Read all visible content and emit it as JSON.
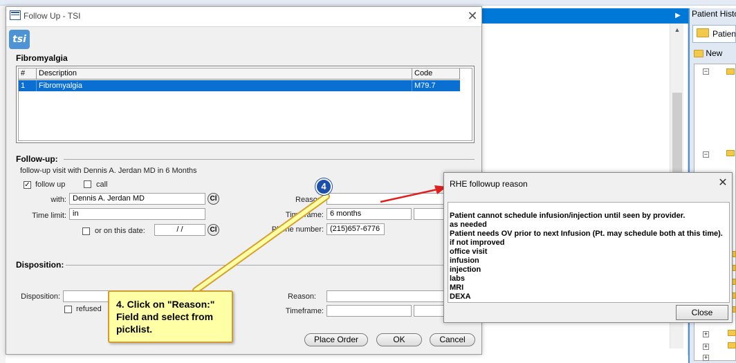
{
  "background_app": {
    "right_panel_title": "Patient Histo",
    "right_panel_tab": "Patien",
    "right_panel_new": "New"
  },
  "dialog": {
    "title": "Follow Up - TSI",
    "logo_text": "tsi",
    "diagnosis": {
      "section_title": "Fibromyalgia",
      "columns": [
        "#",
        "Description",
        "Code"
      ],
      "rows": [
        {
          "num": "1",
          "description": "Fibromyalgia",
          "code": "M79.7"
        }
      ]
    },
    "followup": {
      "section_title": "Follow-up:",
      "summary": "follow-up visit with Dennis A. Jerdan MD in 6 Months",
      "followup_checkbox": {
        "label": "follow up",
        "checked": true
      },
      "call_checkbox": {
        "label": "call",
        "checked": false
      },
      "with_label": "with:",
      "with_value": "Dennis A. Jerdan MD",
      "cl_label": "Cl",
      "time_limit_label": "Time limit:",
      "time_limit_value": "in",
      "on_date_label": "or on this date:",
      "on_date_value": "  /  /",
      "reason_label": "Reason:",
      "reason_value": "",
      "timeframe_label": "Timeframe:",
      "timeframe_value": "6 months",
      "phone_label": "Phone number:",
      "phone_value": "(215)657-6776"
    },
    "disposition": {
      "section_title": "Disposition:",
      "disposition_label": "Disposition:",
      "disposition_value": "",
      "refused_label": "refused",
      "reason_label": "Reason:",
      "reason_value": "",
      "timeframe_label": "Timeframe:",
      "timeframe_value": ""
    },
    "buttons": {
      "place_order": "Place Order",
      "ok": "OK",
      "cancel": "Cancel"
    }
  },
  "annotation": {
    "step_number": "4",
    "callout_text": "4. Click on \"Reason:\" Field and select from picklist.",
    "arrow_color": "#e02020"
  },
  "picklist_popup": {
    "title": "RHE followup reason",
    "items": [
      "Patient cannot schedule infusion/injection until seen by provider.",
      "as needed",
      "Patient needs OV prior to next Infusion (Pt. may schedule both at this time).",
      "if not improved",
      "office visit",
      "infusion",
      "injection",
      "labs",
      "MRI",
      "DEXA"
    ],
    "close_label": "Close"
  },
  "colors": {
    "selection_blue": "#0a6fd1",
    "callout_fill": "#ffffa5",
    "callout_border": "#d39a32",
    "step_circle": "#1c4fa8"
  }
}
